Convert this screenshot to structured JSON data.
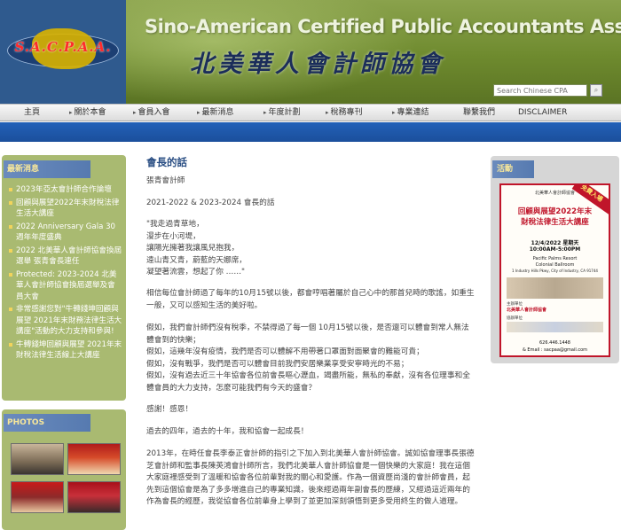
{
  "header": {
    "logo_text": "S.A.C.P.A.A.",
    "title_en": "Sino-American Certified Public Accountants Association",
    "title_zh": "北美華人會計師協會",
    "search_placeholder": "Search Chinese CPA"
  },
  "nav": {
    "items": [
      {
        "label": "主頁",
        "has_arrow": false
      },
      {
        "label": "關於本會",
        "has_arrow": true
      },
      {
        "label": "會員入會",
        "has_arrow": true
      },
      {
        "label": "最新消息",
        "has_arrow": true
      },
      {
        "label": "年度計劃",
        "has_arrow": true
      },
      {
        "label": "稅務專刊",
        "has_arrow": true
      },
      {
        "label": "專業連結",
        "has_arrow": true
      },
      {
        "label": "聯繫我們",
        "has_arrow": false
      },
      {
        "label": "DISCLAIMER",
        "has_arrow": false
      }
    ]
  },
  "sidebar": {
    "news_heading": "最新消息",
    "news_items": [
      "2023年亞太會計師合作論壇",
      "回顧與展望2022年末財稅法律生活大講座",
      "2022 Anniversary Gala 30 週年年度盛典",
      "2022 北美華人會計師協會換屆選舉 張青會長連任",
      "Protected: 2023-2024 北美華人會計師協會換屆選舉及會員大會",
      "非常感謝您對\"牛轉錢坤回顧與展望 2021年末財務法律生活大講座\"活動的大力支持和參與!",
      "牛轉錢坤回顧與展望 2021年末財稅法律生活線上大講座"
    ],
    "photos_heading": "PHOTOS"
  },
  "main": {
    "title": "會長的話",
    "author": "張青會計師",
    "term": "2021-2022 & 2023-2024 會長的話",
    "poem": [
      "\"我走過青草地，",
      "漫步在小河堤，",
      "讓陽光擁著我讓風兒抱我，",
      "遠山青又青，蔚藍的天娜席，",
      "凝望著流雲，想起了你 ……\""
    ],
    "para1": "相信每位會計師過了每年的10月15號以後，都會哼唱著屬於自己心中的那首兒時的歌謠，如重生一般，又可以感知生活的美好啦。",
    "para2": [
      "假如，我們會計師們沒有稅季，不禁得過了每一個 10月15號以後，是否還可以體會到常人無法體會到的快樂；",
      "假如，這幾年沒有疫情，我們是否可以體解不用帶著口罩面對面聚會的難能可貴；",
      "假如，沒有戰爭，我們是否可以體會目前我們安居樂業享受安寧時光的不易；",
      "假如，沒有過去近三十年協會各位前會長嘔心瀝血，竭盡所能，無私的奉獻，沒有各位理事和全體會員的大力支持，怎麼可能我們有今天的盛會？"
    ],
    "thanks": "感謝！感恩！",
    "para3": "過去的四年，過去的十年，我和協會一起成長！",
    "para4": "2013年，在時任會長李泰正會計師的指引之下加入到北美華人會計師協會。誠如協會理事長張德芝會計師和監事長陳英鴻會計師所言，我們北美華人會計師協會是一個快樂的大家庭！我在這個大家庭裡感受到了溫暖和協會各位前輩對我的關心和愛護。作為一個資歷尚淺的會計師會員，起先到這個協會是為了多多增進自己的專業知識，後來經過兩年副會長的歷練，又經過這近兩年的作為會長的經歷，我從協會各位前輩身上學到了並更加深刻領悟到更多受用終生的做人道理。"
  },
  "right_sidebar": {
    "events_heading": "活動",
    "flyer": {
      "org": "北美華人會計師協會",
      "badge": "免費入場",
      "headline_1": "回顧與展望2022年末",
      "headline_2": "財稅法律生活大講座",
      "date": "12/4/2022 星期天",
      "time": "10:00AM-5:00PM",
      "venue_1": "Pacific Palms Resort",
      "venue_2": "Colonial Ballroom",
      "address": "1 Industry Hills Pkwy, City of Industry, CA 91744",
      "host_label": "主辦單位",
      "host": "北美華人會計師協會",
      "cohost_label": "協辦單位",
      "phone": "626.446.1448",
      "email": "& Email : sacpaa@gmail.com"
    }
  },
  "colors": {
    "nav_blue": "#1f57a8",
    "sidebar_green": "#a9ba71",
    "heading_blue": "#2b4f84",
    "flyer_red": "#c0152a"
  }
}
